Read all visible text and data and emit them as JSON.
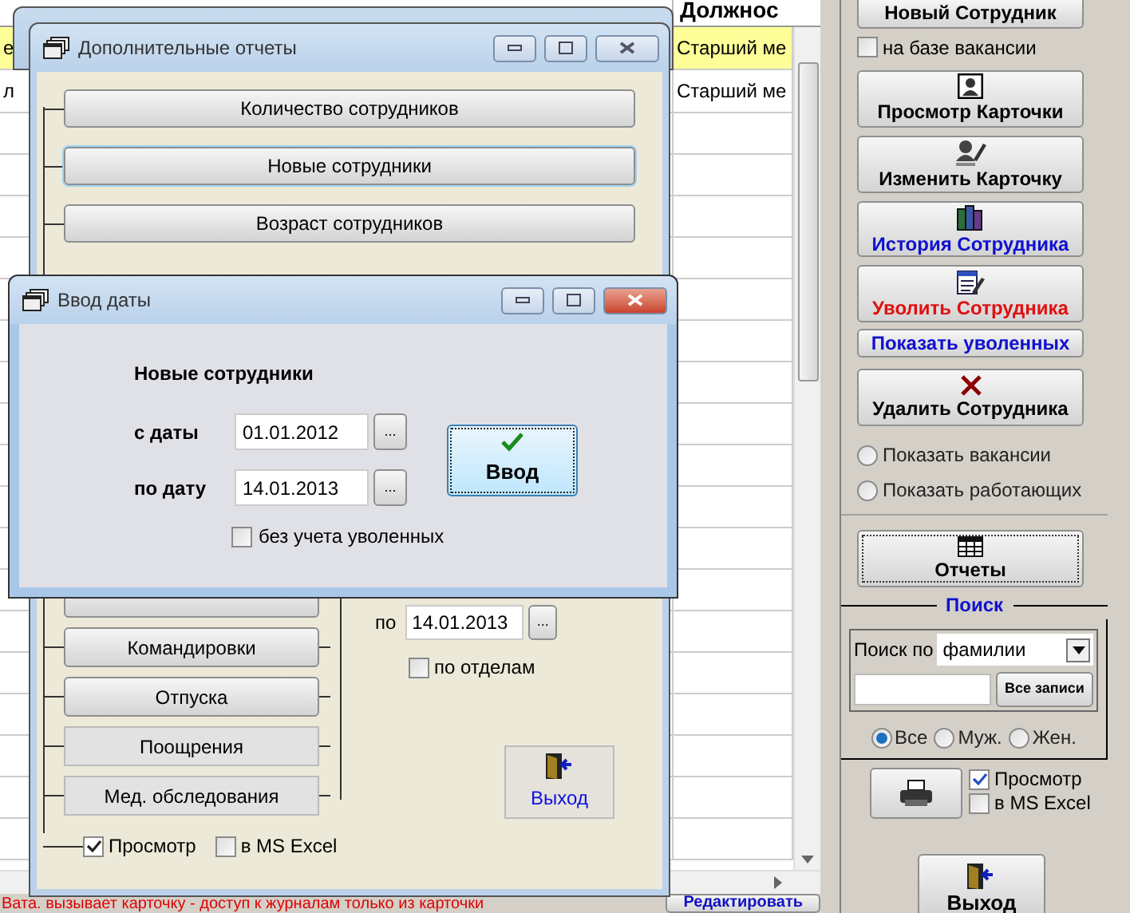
{
  "table": {
    "columns": [
      {},
      {
        "label": "Должнос"
      }
    ],
    "rows": [
      {
        "cells": [
          "е",
          "Старший ме"
        ],
        "selected": true
      },
      {
        "cells": [
          "л",
          "Старший ме"
        ],
        "selected": false
      }
    ]
  },
  "status_bar": {
    "message": "Вата. вызывает карточку - доступ к журналам только из карточки",
    "button": "Редактировать"
  },
  "side_panel": {
    "items": [
      {
        "kind": "button",
        "label": "Новый Сотрудник",
        "color": "#000000"
      },
      {
        "kind": "checkbox",
        "label": "на базе вакансии",
        "checked": false
      },
      {
        "kind": "icon_button",
        "label": "Просмотр Карточки",
        "color": "#000000",
        "focused": false
      },
      {
        "kind": "icon_button",
        "label": "Изменить Карточку",
        "color": "#000000",
        "focused": false
      },
      {
        "kind": "icon_button",
        "label": "История Сотрудника",
        "color": "#1010d0",
        "focused": false
      },
      {
        "kind": "icon_button",
        "label": "Уволить Сотрудника",
        "color": "#e01010",
        "focused": false
      },
      {
        "kind": "button",
        "label": "Показать уволенных",
        "color": "#1010d0"
      },
      {
        "kind": "icon_button",
        "label": "Удалить Сотрудника",
        "color": "#000000",
        "focused": false
      },
      {
        "kind": "radio",
        "label": "Показать вакансии",
        "selected": false
      },
      {
        "kind": "radio",
        "label": "Показать работающих",
        "selected": false
      },
      {
        "kind": "icon_button",
        "label": "Отчеты",
        "color": "#000000",
        "focused": true
      }
    ],
    "search": {
      "title": "Поиск",
      "by_label": "Поиск по",
      "by_value": "фамилии",
      "all_button": "Все записи",
      "filters": [
        {
          "label": "Все",
          "selected": true
        },
        {
          "label": "Муж.",
          "selected": false
        },
        {
          "label": "Жен.",
          "selected": false
        }
      ]
    },
    "print": {
      "preview": {
        "label": "Просмотр",
        "checked": true
      },
      "excel": {
        "label": "в MS Excel",
        "checked": false
      }
    },
    "exit": {
      "label": "Выход"
    }
  },
  "report_window": {
    "title": "Дополнительные отчеты",
    "active": false,
    "top_buttons": [
      {
        "label": "Количество сотрудников",
        "focused": false
      },
      {
        "label": "Новые сотрудники",
        "focused": true
      },
      {
        "label": "Возраст сотрудников",
        "focused": false
      }
    ],
    "list_buttons": [
      {
        "flat": false
      },
      {
        "label": "Командировки",
        "flat": false
      },
      {
        "label": "Отпуска",
        "flat": false
      },
      {
        "label": "Поощрения",
        "flat": true
      },
      {
        "label": "Мед. обследования",
        "flat": true
      }
    ],
    "to_label": "по",
    "to_date": "14.01.2013",
    "browse": "...",
    "by_departments": {
      "label": "по отделам",
      "checked": false
    },
    "exit": {
      "label": "Выход"
    },
    "preview": {
      "label": "Просмотр",
      "checked": true
    },
    "excel": {
      "label": "в MS Excel",
      "checked": false
    }
  },
  "date_dialog": {
    "title": "Ввод даты",
    "active": true,
    "heading": "Новые сотрудники",
    "fields": [
      {
        "label": "с даты",
        "value": "01.01.2012",
        "button": "..."
      },
      {
        "label": "по дату",
        "value": "14.01.2013",
        "button": "..."
      }
    ],
    "submit": {
      "label": "Ввод",
      "focused": true
    },
    "option": {
      "label": "без учета уволенных",
      "checked": false
    }
  }
}
